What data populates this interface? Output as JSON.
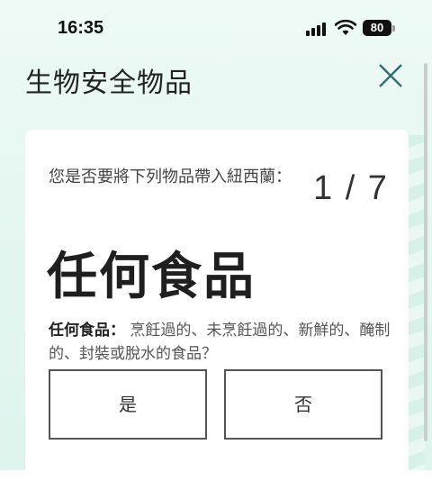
{
  "status_bar": {
    "time": "16:35",
    "battery": "80",
    "icons": [
      "signal-icon",
      "wifi-icon",
      "battery-icon"
    ]
  },
  "header": {
    "title": "生物安全物品",
    "close_icon": "close-icon"
  },
  "card": {
    "question": "您是否要將下列物品帶入紐西蘭：",
    "counter": "1 / 7",
    "item_title": "任何食品",
    "description_label": "任何食品：",
    "description_text": "烹飪過的、未烹飪過的、新鮮的、醃制的、封裝或脫水的食品？",
    "yes_label": "是",
    "no_label": "否"
  },
  "colors": {
    "background": "#e6f7f1",
    "text": "#222222",
    "accent": "#2f6f73"
  }
}
